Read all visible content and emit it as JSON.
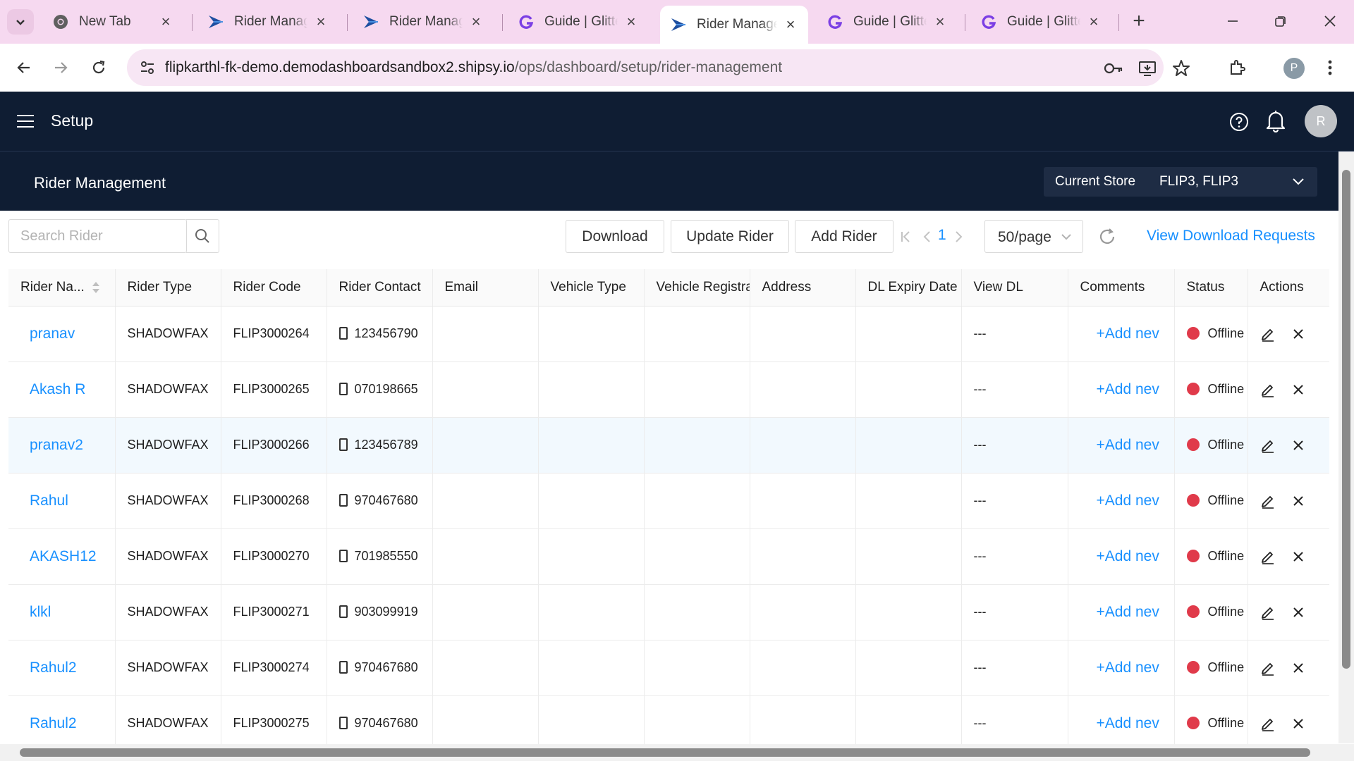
{
  "browser": {
    "tabs": [
      {
        "title": "New Tab",
        "icon": "chrome-icon",
        "active": false
      },
      {
        "title": "Rider Management",
        "icon": "shipsy-icon",
        "active": false
      },
      {
        "title": "Rider Management",
        "icon": "shipsy-icon",
        "active": false
      },
      {
        "title": "Guide | Glitter",
        "icon": "glitter-icon",
        "active": false
      },
      {
        "title": "Rider Management",
        "icon": "shipsy-icon",
        "active": true
      },
      {
        "title": "Guide | Glitter",
        "icon": "glitter-icon",
        "active": false
      },
      {
        "title": "Guide | Glitter",
        "icon": "glitter-icon",
        "active": false
      }
    ],
    "url_host": "flipkarthl-fk-demo.demodashboardsandbox2.shipsy.io",
    "url_path": "/ops/dashboard/setup/rider-management",
    "profile_initial": "P"
  },
  "header": {
    "title": "Setup",
    "avatar_initial": "R"
  },
  "subheader": {
    "page_title": "Rider Management",
    "store_label": "Current Store",
    "store_value": "FLIP3, FLIP3"
  },
  "toolbar": {
    "search_placeholder": "Search Rider",
    "download_label": "Download",
    "update_label": "Update Rider",
    "add_label": "Add Rider",
    "page_number": "1",
    "page_size": "50/page",
    "download_requests_label": "View Download Requests"
  },
  "table": {
    "columns": [
      "Rider Na...",
      "Rider Type",
      "Rider Code",
      "Rider Contact",
      "Email",
      "Vehicle Type",
      "Vehicle Registrat",
      "Address",
      "DL Expiry Date",
      "View DL",
      "Comments",
      "Status",
      "Actions"
    ],
    "rows": [
      {
        "name": "pranav",
        "type": "SHADOWFAX",
        "code": "FLIP3000264",
        "contact": "123456790",
        "view_dl": "---",
        "comment": "+Add nev",
        "status": "Offline"
      },
      {
        "name": "Akash R",
        "type": "SHADOWFAX",
        "code": "FLIP3000265",
        "contact": "070198665",
        "view_dl": "---",
        "comment": "+Add nev",
        "status": "Offline"
      },
      {
        "name": "pranav2",
        "type": "SHADOWFAX",
        "code": "FLIP3000266",
        "contact": "123456789",
        "view_dl": "---",
        "comment": "+Add nev",
        "status": "Offline"
      },
      {
        "name": "Rahul",
        "type": "SHADOWFAX",
        "code": "FLIP3000268",
        "contact": "970467680",
        "view_dl": "---",
        "comment": "+Add nev",
        "status": "Offline"
      },
      {
        "name": "AKASH12",
        "type": "SHADOWFAX",
        "code": "FLIP3000270",
        "contact": "701985550",
        "view_dl": "---",
        "comment": "+Add nev",
        "status": "Offline"
      },
      {
        "name": "klkl",
        "type": "SHADOWFAX",
        "code": "FLIP3000271",
        "contact": "903099919",
        "view_dl": "---",
        "comment": "+Add nev",
        "status": "Offline"
      },
      {
        "name": "Rahul2",
        "type": "SHADOWFAX",
        "code": "FLIP3000274",
        "contact": "970467680",
        "view_dl": "---",
        "comment": "+Add nev",
        "status": "Offline"
      },
      {
        "name": "Rahul2",
        "type": "SHADOWFAX",
        "code": "FLIP3000275",
        "contact": "970467680",
        "view_dl": "---",
        "comment": "+Add nev",
        "status": "Offline"
      }
    ]
  },
  "colors": {
    "header_bg": "#0f1d33",
    "link": "#1890ff",
    "status_offline": "#e03a4a",
    "tabbar_bg": "#f6d9f0"
  }
}
